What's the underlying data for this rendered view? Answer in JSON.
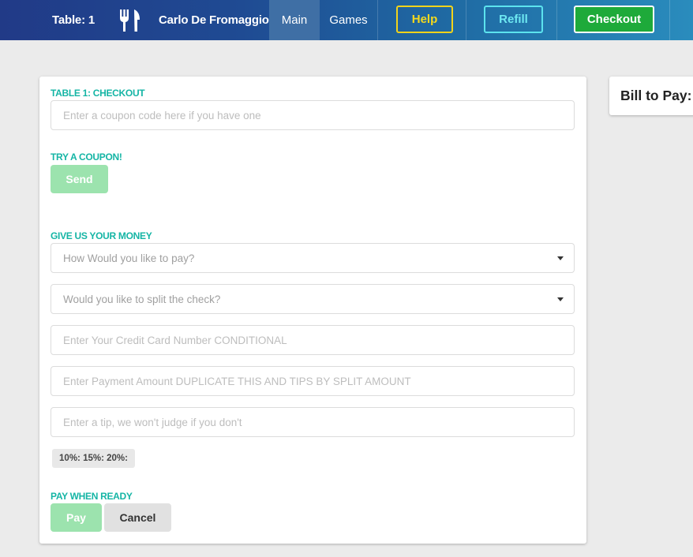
{
  "header": {
    "table_label": "Table: 1",
    "waiter_name": "Carlo De Fromaggio",
    "nav": {
      "main": "Main",
      "games": "Games"
    },
    "buttons": {
      "help": "Help",
      "refill": "Refill",
      "checkout": "Checkout"
    },
    "colors": {
      "help": "#f5d91c",
      "refill": "#6ee9f2",
      "checkout": "#1eaa3a"
    }
  },
  "checkout": {
    "title": "TABLE 1: CHECKOUT",
    "coupon": {
      "placeholder": "Enter a coupon code here if you have one",
      "heading": "TRY A COUPON!",
      "send_label": "Send"
    },
    "payment": {
      "heading": "GIVE US YOUR MONEY",
      "method_select": "How Would you like to pay?",
      "split_select": "Would you like to split the check?",
      "card_placeholder": "Enter Your Credit Card Number CONDITIONAL",
      "amount_placeholder": "Enter Payment Amount DUPLICATE THIS AND TIPS BY SPLIT AMOUNT",
      "tip_placeholder": "Enter a tip, we won't judge if you don't",
      "tip_presets": "10%: 15%: 20%:"
    },
    "actions": {
      "heading": "PAY WHEN READY",
      "pay_label": "Pay",
      "cancel_label": "Cancel"
    }
  },
  "bill": {
    "title": "Bill to Pay:"
  }
}
